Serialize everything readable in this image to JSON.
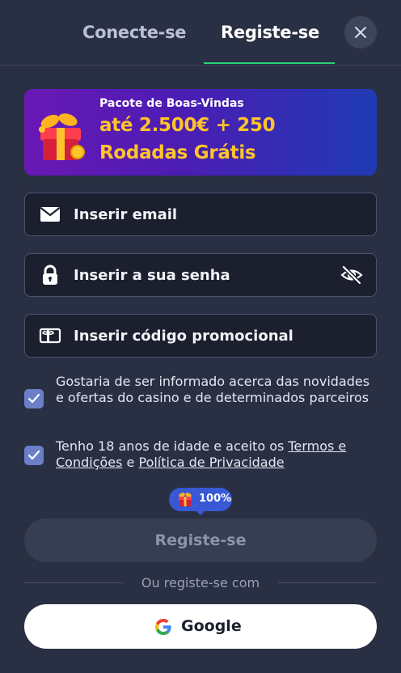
{
  "tabs": {
    "login": "Conecte-se",
    "register": "Registe-se",
    "active": "register"
  },
  "banner": {
    "subtitle": "Pacote de Boas-Vindas",
    "line1": "até 2.500€ + 250",
    "line2": "Rodadas Grátis"
  },
  "fields": {
    "email_placeholder": "Inserir email",
    "password_placeholder": "Inserir a sua senha",
    "promo_placeholder": "Inserir código promocional"
  },
  "consents": {
    "newsletter": {
      "checked": true,
      "text": "Gostaria de ser informado acerca das novidades e ofertas do casino e de determinados parceiros"
    },
    "age": {
      "checked": true,
      "prefix": "Tenho 18 anos de idade e aceito os ",
      "terms_link": "Termos e Condições",
      "joiner": " e ",
      "privacy_link": "Política de Privacidade"
    }
  },
  "bonus_badge": "100%",
  "submit_label": "Registe-se",
  "divider_text": "Ou registe-se com",
  "google_label": "Google",
  "icons": [
    "close-icon",
    "gift-box-icon",
    "mail-icon",
    "lock-icon",
    "eye-off-icon",
    "ticket-icon",
    "check-icon",
    "google-logo-icon"
  ],
  "colors": {
    "accent_green": "#2bd27a",
    "banner_gold": "#ffc42c",
    "checkbox": "#6b7fc8",
    "badge_blue": "#3858d6"
  }
}
